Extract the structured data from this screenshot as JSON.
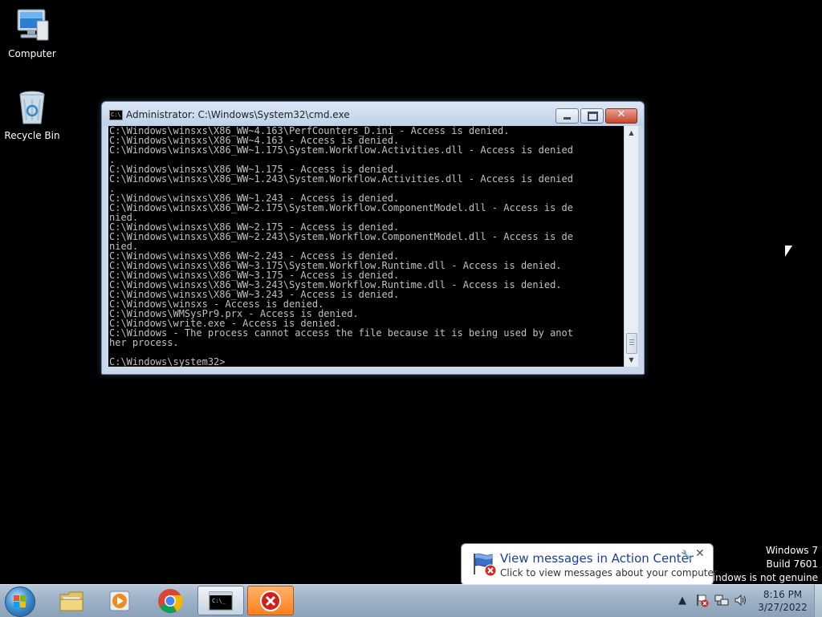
{
  "desktop": {
    "icons": [
      {
        "label": "Computer"
      },
      {
        "label": "Recycle Bin"
      }
    ]
  },
  "cmd_window": {
    "title": "Administrator: C:\\Windows\\System32\\cmd.exe",
    "lines": [
      "C:\\Windows\\winsxs\\X86_WW~4.163\\PerfCounters_D.ini - Access is denied.",
      "C:\\Windows\\winsxs\\X86_WW~4.163 - Access is denied.",
      "C:\\Windows\\winsxs\\X86_WW~1.175\\System.Workflow.Activities.dll - Access is denied",
      ".",
      "C:\\Windows\\winsxs\\X86_WW~1.175 - Access is denied.",
      "C:\\Windows\\winsxs\\X86_WW~1.243\\System.Workflow.Activities.dll - Access is denied",
      ".",
      "C:\\Windows\\winsxs\\X86_WW~1.243 - Access is denied.",
      "C:\\Windows\\winsxs\\X86_WW~2.175\\System.Workflow.ComponentModel.dll - Access is de",
      "nied.",
      "C:\\Windows\\winsxs\\X86_WW~2.175 - Access is denied.",
      "C:\\Windows\\winsxs\\X86_WW~2.243\\System.Workflow.ComponentModel.dll - Access is de",
      "nied.",
      "C:\\Windows\\winsxs\\X86_WW~2.243 - Access is denied.",
      "C:\\Windows\\winsxs\\X86_WW~3.175\\System.Workflow.Runtime.dll - Access is denied.",
      "C:\\Windows\\winsxs\\X86_WW~3.175 - Access is denied.",
      "C:\\Windows\\winsxs\\X86_WW~3.243\\System.Workflow.Runtime.dll - Access is denied.",
      "C:\\Windows\\winsxs\\X86_WW~3.243 - Access is denied.",
      "C:\\Windows\\winsxs - Access is denied.",
      "C:\\Windows\\WMSysPr9.prx - Access is denied.",
      "C:\\Windows\\write.exe - Access is denied.",
      "C:\\Windows - The process cannot access the file because it is being used by anot",
      "her process.",
      "",
      "C:\\Windows\\system32>"
    ]
  },
  "watermark": {
    "line1": "Windows 7",
    "line2": "Build 7601",
    "line3": "Windows is not genuine"
  },
  "balloon": {
    "title": "View messages in Action Center",
    "text": "Click to view messages about your computer."
  },
  "taskbar": {
    "pinned": [
      "windows-explorer",
      "media-player",
      "chrome",
      "cmd",
      "error-app"
    ]
  },
  "clock": {
    "time": "8:16 PM",
    "date": "3/27/2022"
  },
  "colors": {
    "console_text": "#c0c0c0",
    "balloon_title": "#1c3f94",
    "error_task": "#ff7f1c"
  }
}
